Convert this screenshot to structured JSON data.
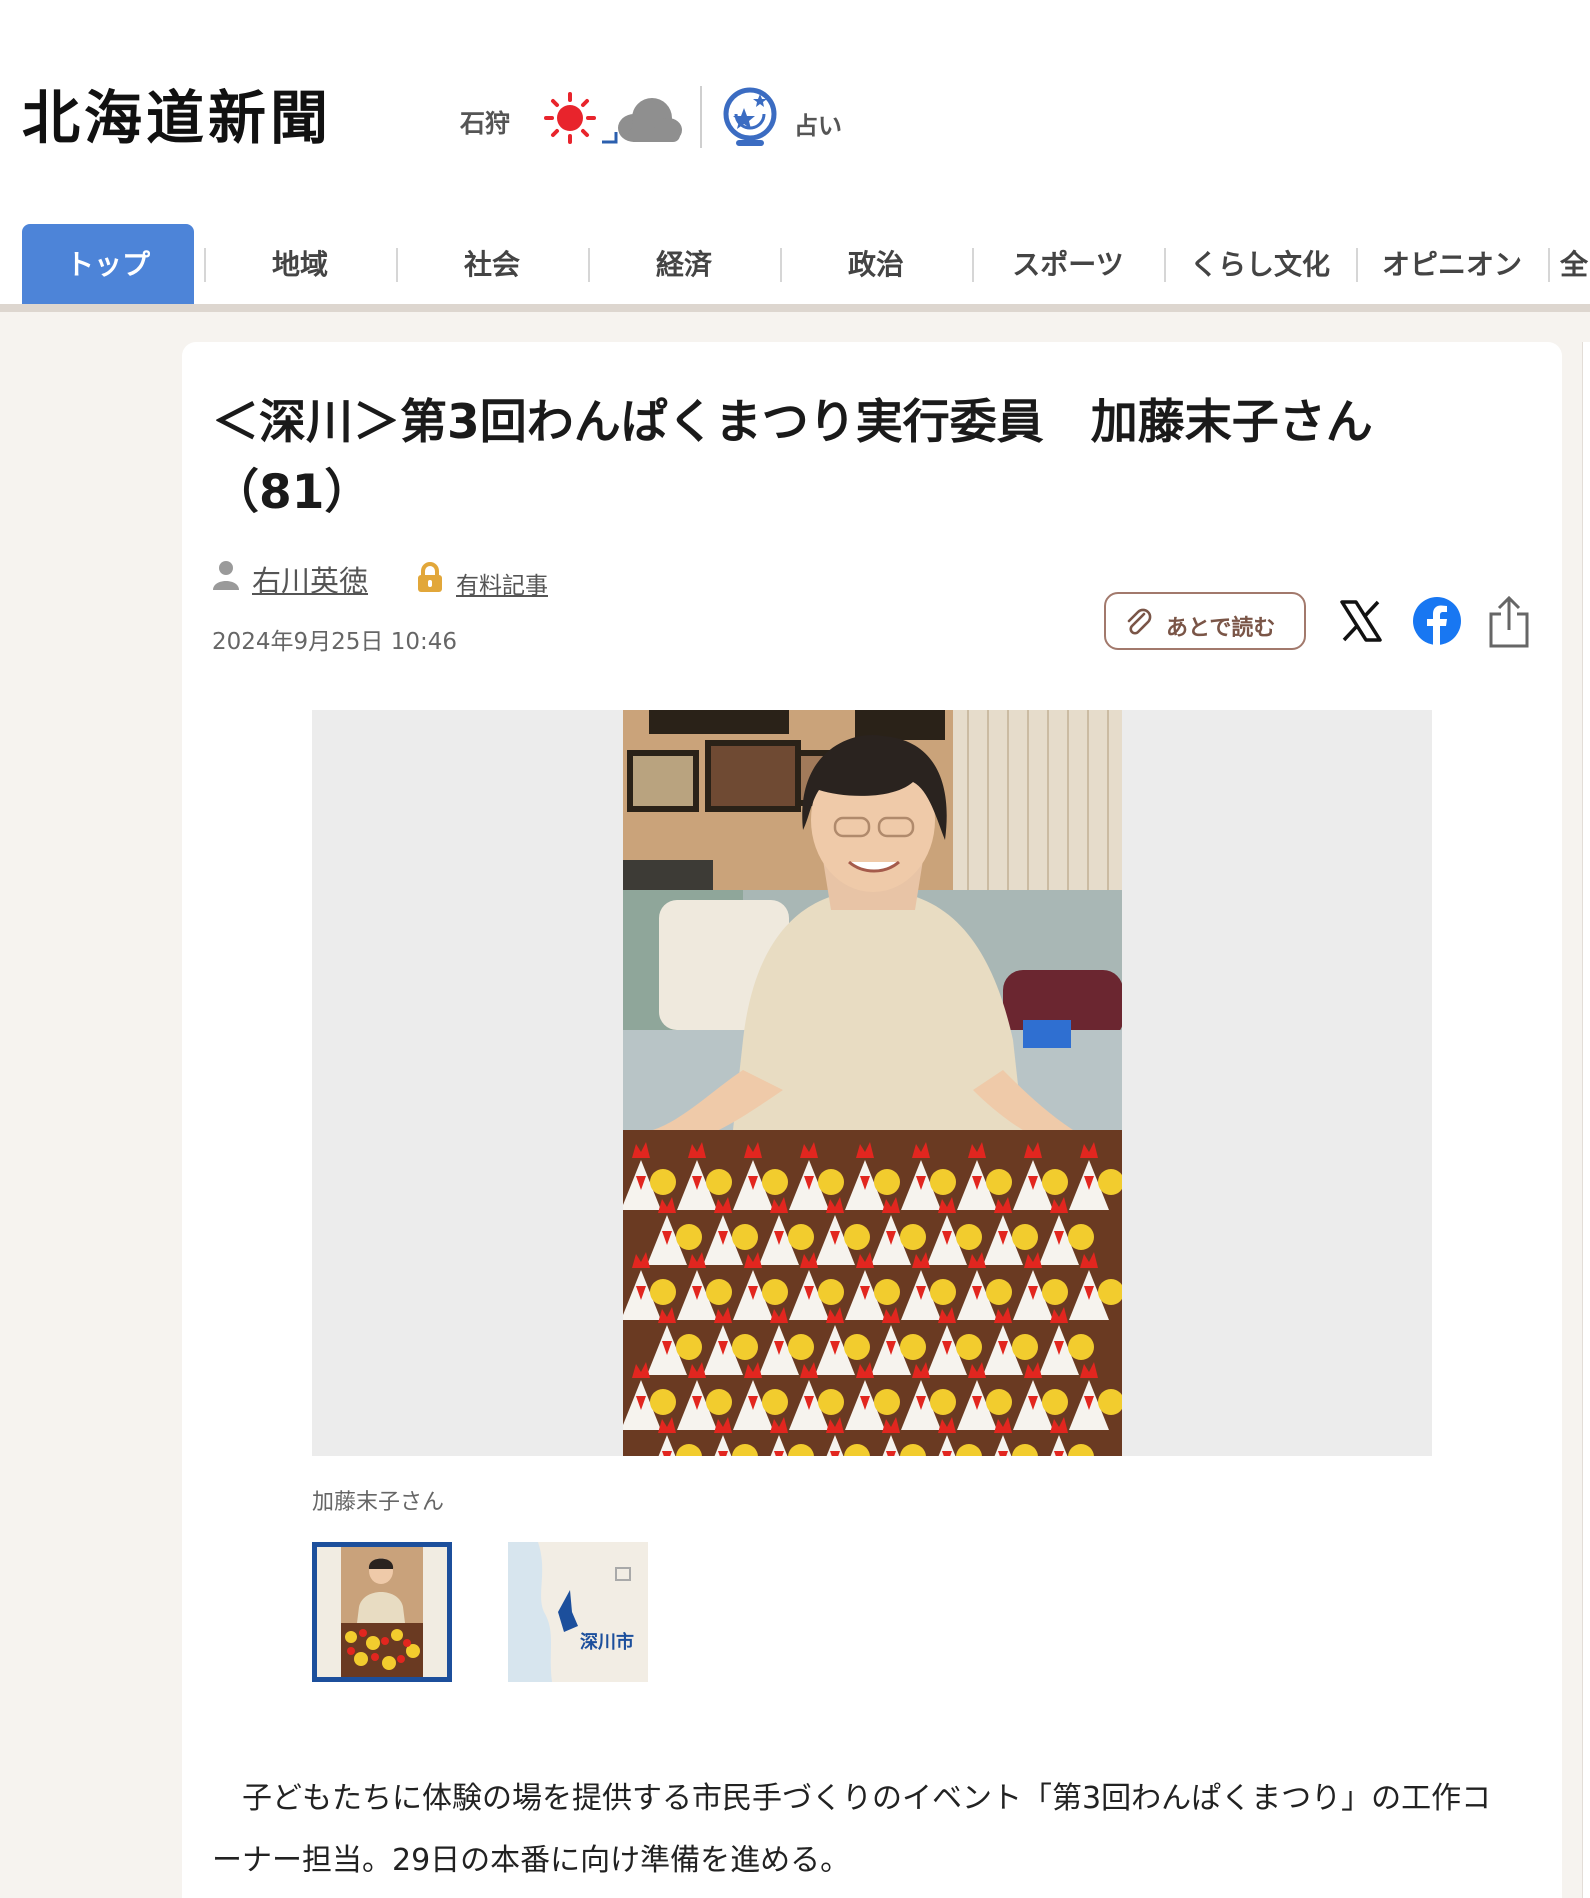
{
  "header": {
    "logo": "北海道新聞",
    "region": "石狩",
    "fortune_label": "占い",
    "weather_icons": [
      "sun-icon",
      "cloud-icon"
    ]
  },
  "nav": {
    "items": [
      {
        "label": "トップ",
        "active": true
      },
      {
        "label": "地域"
      },
      {
        "label": "社会"
      },
      {
        "label": "経済"
      },
      {
        "label": "政治"
      },
      {
        "label": "スポーツ"
      },
      {
        "label": "くらし文化"
      },
      {
        "label": "オピニオン"
      },
      {
        "label": "全"
      }
    ]
  },
  "article": {
    "title": "＜深川＞第3回わんぱくまつり実行委員　加藤末子さん（81）",
    "author": "右川英徳",
    "paid_label": "有料記事",
    "date": "2024年9月25日 10:46",
    "read_later": "あとで読む",
    "share_icons": [
      "x-icon",
      "facebook-icon",
      "share-icon"
    ],
    "photo_caption": "加藤末子さん",
    "map_label": "深川市",
    "body": "　子どもたちに体験の場を提供する市民手づくりのイベント「第3回わんぱくまつり」の工作コーナー担当。29日の本番に向け準備を進める。"
  },
  "colors": {
    "nav_active": "#4d84d8",
    "nav_active_bar": "#1f4f9c",
    "read_later_border": "#a2796c",
    "facebook": "#1877f2"
  }
}
